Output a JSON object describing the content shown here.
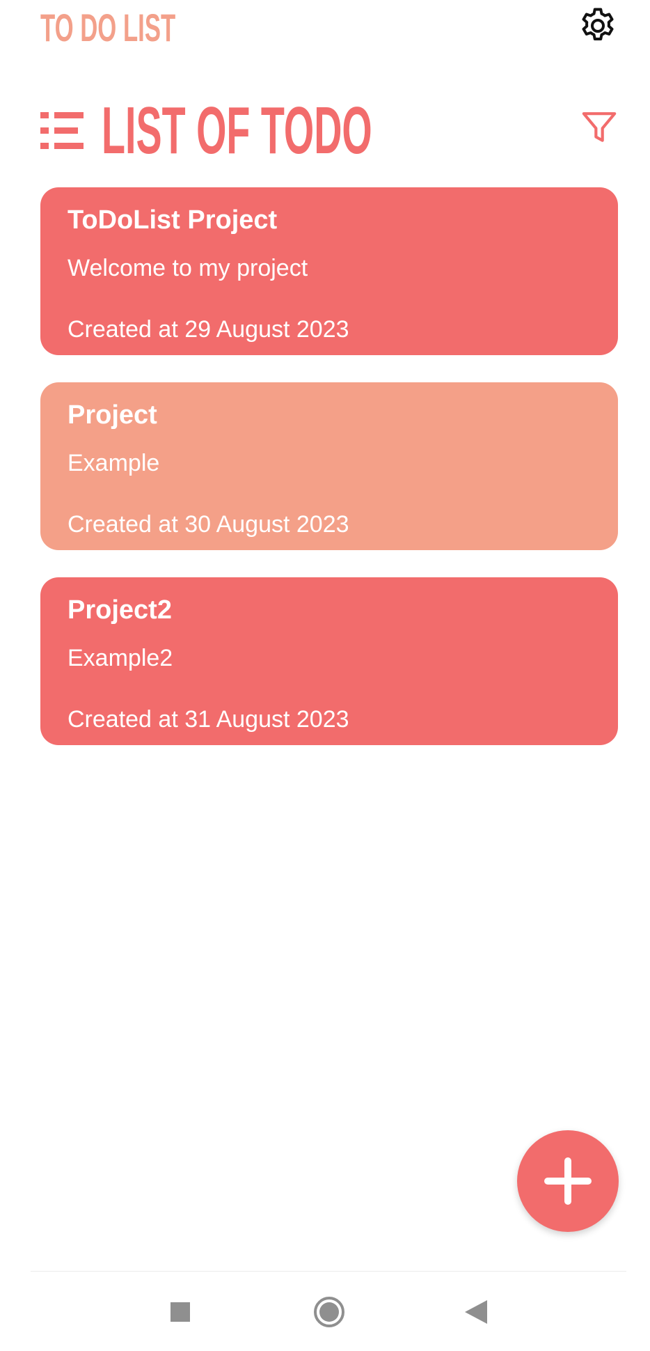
{
  "app": {
    "title": "TO DO LIST",
    "accent_color": "#f26c6c",
    "title_color": "#f3a08a"
  },
  "header": {
    "list_title": "LIST OF TODO",
    "settings_icon": "gear-icon",
    "filter_icon": "filter-icon",
    "list_icon": "list-icon"
  },
  "todos": [
    {
      "title": "ToDoList Project",
      "description": "Welcome to my project",
      "created": "Created at 29 August 2023",
      "color": "#f26c6c"
    },
    {
      "title": "Project",
      "description": "Example",
      "created": "Created at 30 August 2023",
      "color": "#f4a088"
    },
    {
      "title": "Project2",
      "description": "Example2",
      "created": "Created at 31 August 2023",
      "color": "#f26c6c"
    }
  ],
  "fab": {
    "icon": "plus-icon"
  },
  "navbar": {
    "items": [
      "recent-apps-icon",
      "home-icon",
      "back-icon"
    ]
  }
}
